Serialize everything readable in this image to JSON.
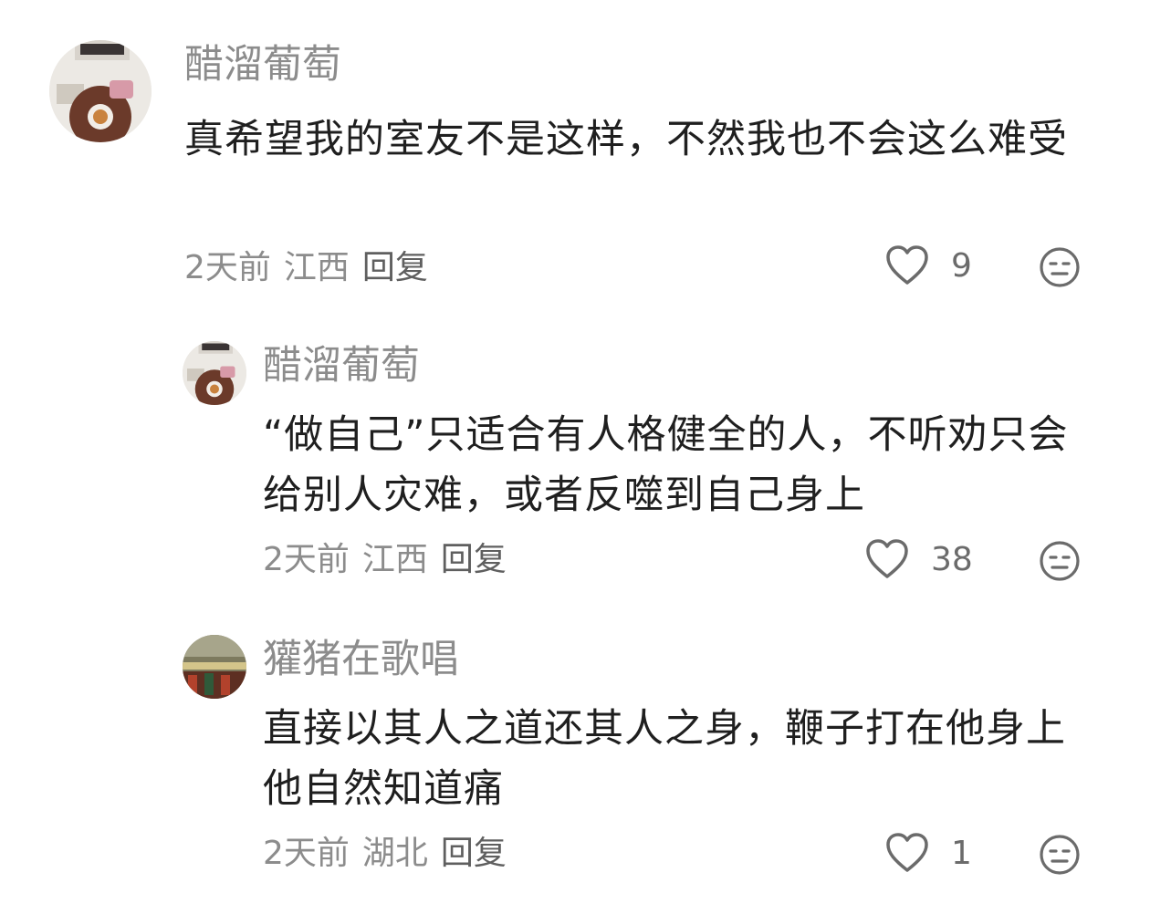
{
  "comments": [
    {
      "username": "醋溜葡萄",
      "content": "真希望我的室友不是这样，不然我也不会这么难受",
      "time": "2天前",
      "location": "江西",
      "reply_label": "回复",
      "likes": "9"
    },
    {
      "username": "醋溜葡萄",
      "content": "“做自己”只适合有人格健全的人，不听劝只会给别人灾难，或者反噬到自己身上",
      "time": "2天前",
      "location": "江西",
      "reply_label": "回复",
      "likes": "38"
    },
    {
      "username": "獾猪在歌唱",
      "content": "直接以其人之道还其人之身，鞭子打在他身上他自然知道痛",
      "time": "2天前",
      "location": "湖北",
      "reply_label": "回复",
      "likes": "1"
    }
  ],
  "icons": {
    "like": "heart-outline-icon",
    "emoji": "neutral-face-icon"
  }
}
